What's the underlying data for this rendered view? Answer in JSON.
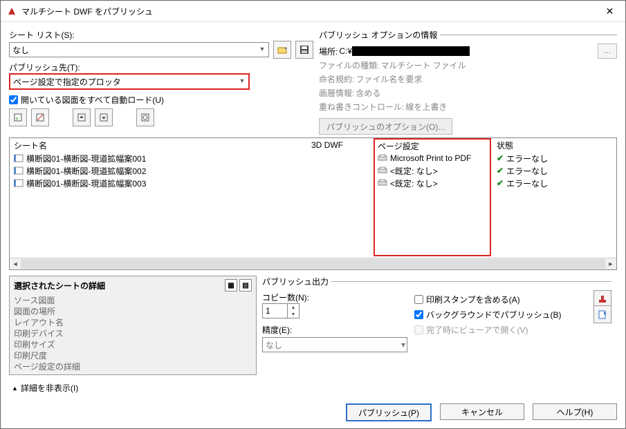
{
  "window": {
    "title": "マルチシート DWF をパブリッシュ"
  },
  "sheetlist": {
    "label": "シート リスト(S):",
    "value": "なし"
  },
  "publish_to": {
    "label": "パブリッシュ先(T):",
    "value": "ページ設定で指定のプロッタ"
  },
  "autoload": {
    "label": "開いている図面をすべて自動ロード(U)"
  },
  "options": {
    "legend": "パブリッシュ オプションの情報",
    "location_k": "場所:",
    "location_v": "C:¥",
    "filetype_k": "ファイルの種類:",
    "filetype_v": "マルチシート ファイル",
    "naming_k": "命名規約:",
    "naming_v": "ファイル名を要求",
    "layer_k": "画層情報:",
    "layer_v": "含める",
    "overwrite_k": "重ね書きコントロール:",
    "overwrite_v": "線を上書き",
    "button": "パブリッシュのオプション(O)..."
  },
  "grid": {
    "headers": {
      "sheet": "シート名",
      "dwf3d": "3D DWF",
      "page": "ページ設定",
      "state": "状態"
    },
    "rows": [
      {
        "sheet": "横断図01-横断図-現道拡幅案001",
        "page": "Microsoft Print to PDF",
        "state": "エラーなし"
      },
      {
        "sheet": "横断図01-横断図-現道拡幅案002",
        "page": "<既定: なし>",
        "state": "エラーなし"
      },
      {
        "sheet": "横断図01-横断図-現道拡幅案003",
        "page": "<既定: なし>",
        "state": "エラーなし"
      }
    ]
  },
  "details": {
    "title": "選択されたシートの詳細",
    "lines": [
      "ソース図面",
      "図面の場所",
      "レイアウト名",
      "印刷デバイス",
      "印刷サイズ",
      "印刷尺度",
      "ページ設定の詳細"
    ]
  },
  "output": {
    "legend": "パブリッシュ出力",
    "copies_label": "コピー数(N):",
    "copies_value": "1",
    "precision_label": "精度(E):",
    "precision_value": "なし",
    "stamp": "印刷スタンプを含める(A)",
    "background": "バックグラウンドでパブリッシュ(B)",
    "viewer": "完了時にビューアで開く(V)"
  },
  "show_details": "詳細を非表示(I)",
  "footer": {
    "publish": "パブリッシュ(P)",
    "cancel": "キャンセル",
    "help": "ヘルプ(H)"
  }
}
